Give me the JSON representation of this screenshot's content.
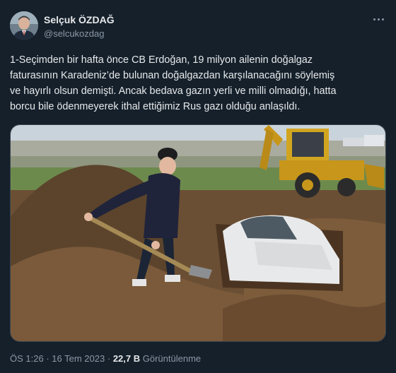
{
  "author": {
    "name": "Selçuk ÖZDAĞ",
    "handle": "@selcukozdag"
  },
  "tweet": {
    "lines": [
      "1-Seçimden bir hafta önce CB Erdoğan, 19 milyon ailenin  doğalgaz",
      "faturasının Karadeniz’de bulunan doğalgazdan karşılanacağını söylemiş",
      "ve hayırlı olsun demişti. Ancak bedava gazın yerli ve milli olmadığı, hatta",
      "borcu bile ödenmeyerek ithal ettiğimiz  Rus gazı olduğu anlaşıldı."
    ]
  },
  "meta": {
    "time": "ÖS 1:26",
    "separator": "·",
    "date": "16 Tem 2023",
    "views_count": "22,7 B",
    "views_label": "Görüntülenme"
  },
  "icons": {
    "more": "more-horizontal-icon"
  },
  "colors": {
    "background": "#15202b",
    "primary_text": "#e7e9ea",
    "secondary_text": "#8b98a5",
    "border": "#38444d"
  }
}
